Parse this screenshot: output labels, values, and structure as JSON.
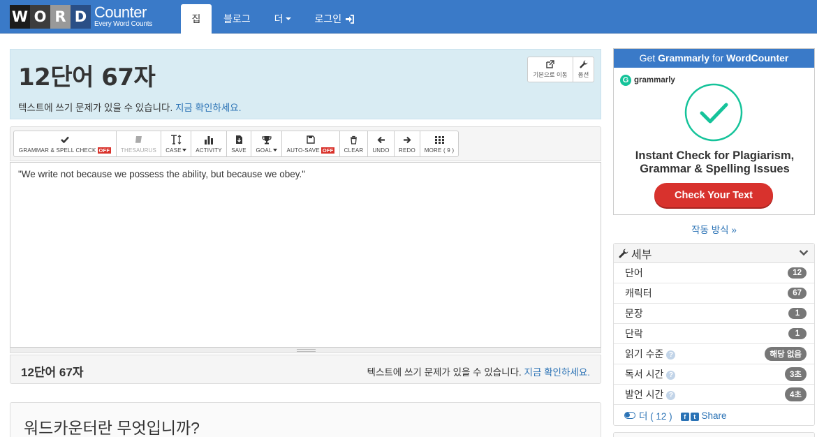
{
  "logo": {
    "tiles": [
      "W",
      "O",
      "R",
      "D"
    ],
    "main": "Counter",
    "sub": "Every Word Counts"
  },
  "nav": {
    "tabs": [
      {
        "label": "집",
        "active": true
      },
      {
        "label": "블로그"
      },
      {
        "label": "더"
      },
      {
        "label": "로그인"
      }
    ]
  },
  "alert": {
    "heading": "12단어 67자",
    "message": "텍스트에 쓰기 문제가 있을 수 있습니다.",
    "link": "지금 확인하세요.",
    "btn_default": "기본으로 이동",
    "btn_options": "옵션"
  },
  "toolbar": {
    "grammar": "GRAMMAR & SPELL CHECK",
    "off": "OFF",
    "thesaurus": "THESAURUS",
    "case": "CASE",
    "activity": "ACTIVITY",
    "save": "SAVE",
    "goal": "GOAL",
    "autosave": "AUTO-SAVE",
    "clear": "CLEAR",
    "undo": "UNDO",
    "redo": "REDO",
    "more": "MORE ( 9 )"
  },
  "editor": {
    "text": "\"We write not because we possess the ability, but because we obey.\""
  },
  "footer": {
    "count": "12단어 67자",
    "message": "텍스트에 쓰기 문제가 있을 수 있습니다.",
    "link": "지금 확인하세요."
  },
  "about": {
    "title": "워드카운터란 무엇입니까?"
  },
  "ad": {
    "head_pre": "Get",
    "head_brand": "Grammarly",
    "head_mid": "for",
    "head_site": "WordCounter",
    "logo_text": "grammarly",
    "title_line1": "Instant Check for Plagiarism,",
    "title_line2": "Grammar & Spelling Issues",
    "button": "Check Your Text",
    "accent": "#15c39a",
    "button_color": "#d8322d"
  },
  "howto": "작동 방식 »",
  "details": {
    "title": "세부",
    "rows": [
      {
        "label": "단어",
        "value": "12"
      },
      {
        "label": "캐릭터",
        "value": "67"
      },
      {
        "label": "문장",
        "value": "1"
      },
      {
        "label": "단락",
        "value": "1"
      },
      {
        "label": "읽기 수준",
        "value": "해당 없음",
        "help": true
      },
      {
        "label": "독서 시간",
        "value": "3초",
        "help": true
      },
      {
        "label": "발언 시간",
        "value": "4초",
        "help": true
      }
    ],
    "more": "더 ( 12 )",
    "share": "Share"
  },
  "colors": {
    "brand": "#3a7ac8",
    "link": "#2a72b5",
    "alert_bg": "#d9ecf3",
    "off_badge": "#d9322b"
  }
}
